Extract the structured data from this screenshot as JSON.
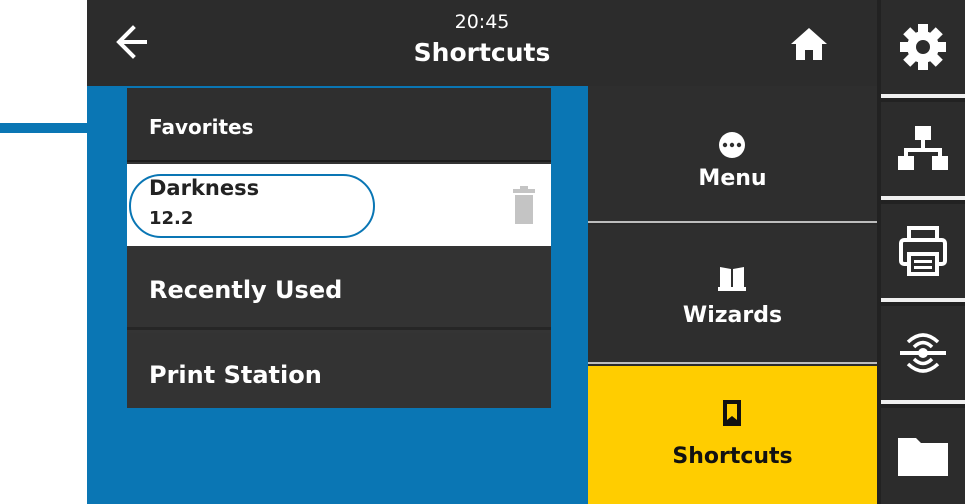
{
  "header": {
    "time": "20:45",
    "title": "Shortcuts"
  },
  "list": {
    "favorites_label": "Favorites",
    "favorite_item": {
      "name": "Darkness",
      "value": "12.2"
    },
    "recently_used_label": "Recently Used",
    "print_station_label": "Print Station"
  },
  "nav": {
    "menu_label": "Menu",
    "wizards_label": "Wizards",
    "shortcuts_label": "Shortcuts"
  },
  "icons": {
    "back": "arrow-left-icon",
    "home": "home-icon",
    "delete": "trash-icon",
    "menu": "menu-dots-icon",
    "wizards": "book-icon",
    "shortcuts": "bookmark-icon",
    "settings": "gear-icon",
    "network": "network-icon",
    "printer": "printer-icon",
    "wireless": "rfid-wireless-icon",
    "storage": "folder-icon"
  },
  "colors": {
    "accent_blue": "#0a76b4",
    "active_yellow": "#ffcd00",
    "panel_dark": "#2c2c2c"
  }
}
